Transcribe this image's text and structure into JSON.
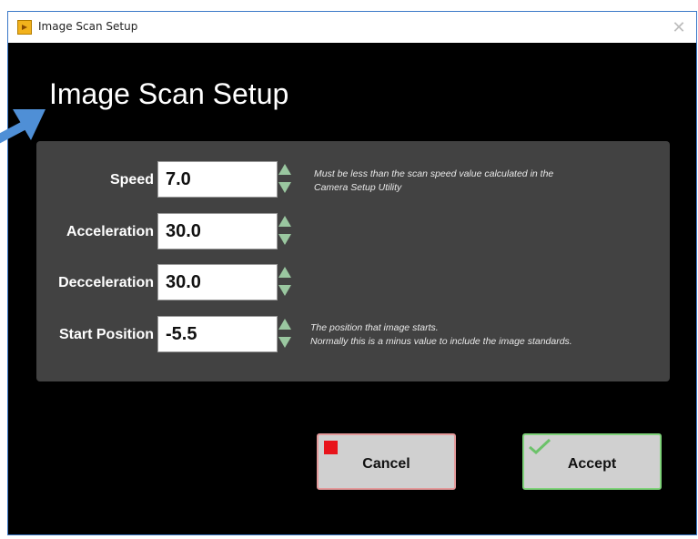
{
  "window": {
    "title": "Image Scan Setup",
    "close_glyph": "✕"
  },
  "heading": "Image Scan Setup",
  "fields": [
    {
      "label": "Speed",
      "value": "7.0"
    },
    {
      "label": "Acceleration",
      "value": "30.0"
    },
    {
      "label": "Decceleration",
      "value": "30.0"
    },
    {
      "label": "Start Position",
      "value": "-5.5"
    }
  ],
  "hints": {
    "speed": [
      "Must be less than the scan speed  value calculated in the",
      "Camera Setup Utility"
    ],
    "start_position": [
      "The position that image starts.",
      "Normally this is a minus value to include the image standards."
    ]
  },
  "buttons": {
    "cancel": "Cancel",
    "accept": "Accept"
  },
  "icons": {
    "app": "labview-vi-icon",
    "cancel": "stop-square-icon",
    "accept": "checkmark-icon",
    "spin_up": "spin-up-arrow-icon",
    "spin_down": "spin-down-arrow-icon",
    "annotation": "pointer-arrow-icon"
  },
  "colors": {
    "window_bg": "#000000",
    "panel_bg": "#424242",
    "spinner": "#9ac7a0",
    "cancel_icon": "#e8141b",
    "accept_icon": "#6cc26a",
    "annotation_arrow": "#4f8fd6"
  }
}
